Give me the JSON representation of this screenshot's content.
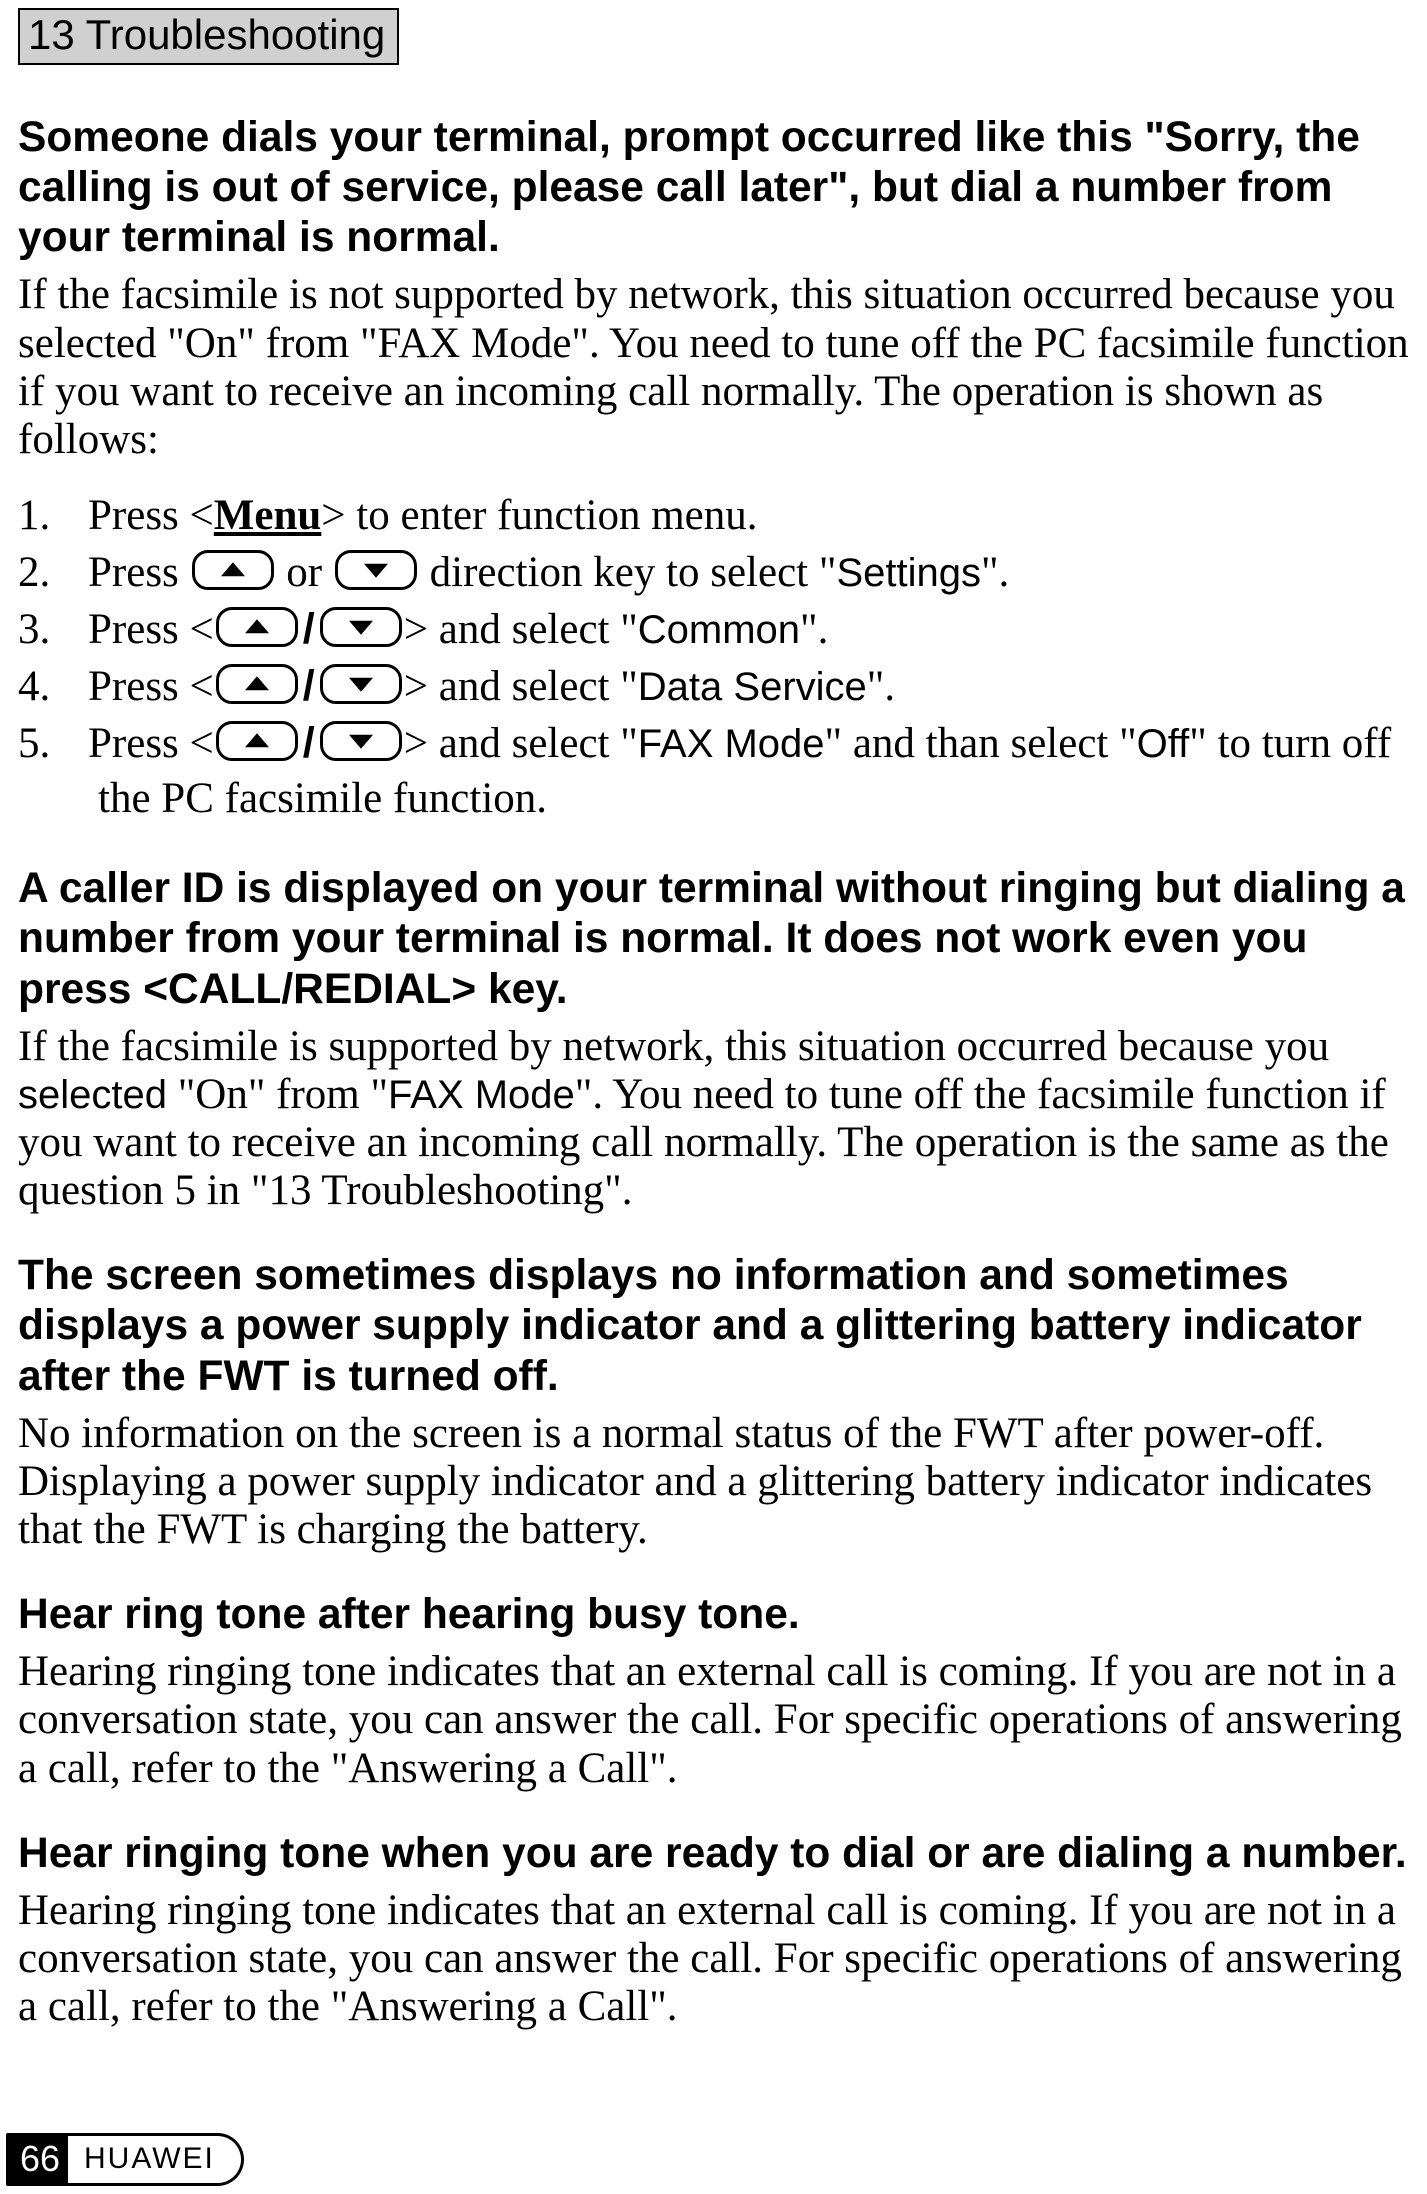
{
  "chapter": {
    "label": "13  Troubleshooting"
  },
  "s1": {
    "heading": "Someone dials your terminal, prompt occurred like this \"Sorry, the calling is out of service, please call later\", but dial a number from your terminal is normal.",
    "body": "If the facsimile is not supported by network, this situation occurred because you selected \"On\" from \"FAX Mode\". You need to tune off the PC facsimile function if you want to receive an incoming call normally. The operation is shown as follows:",
    "steps": {
      "n1": "1.",
      "n2": "2.",
      "n3": "3.",
      "n4": "4.",
      "n5": "5.",
      "t1a": "Press <",
      "t1b": "Menu",
      "t1c": "> to enter function menu.",
      "t2a": "Press ",
      "t2b": " or ",
      "t2c": " direction key to select \"",
      "t2d": "Settings",
      "t2e": "\".",
      "t3a": "Press <",
      "t3b": "> and select \"",
      "t3c": "Common",
      "t3d": "\".",
      "t4a": "Press <",
      "t4b": "> and select \"",
      "t4c": "Data Service",
      "t4d": "\".",
      "t5a": "Press <",
      "t5b": "> and select \"",
      "t5c": "FAX Mode",
      "t5d": "\" and than select \"",
      "t5e": "Off",
      "t5f": "\" to turn off the PC facsimile function.",
      "slash": "/"
    }
  },
  "s2": {
    "heading": "A caller ID is displayed on your terminal without ringing but dialing a number from your terminal is normal. It does not work even you press <CALL/REDIAL> key.",
    "body_a": "If the facsimile is supported by network, this situation occurred because you ",
    "body_b": "selected",
    "body_c": " \"On\" from \"",
    "body_d": "FAX Mode",
    "body_e": "\". You need to tune off the facsimile function if you want to receive an incoming call normally. The operation is the same as the question 5 in \"13  Troubleshooting\"."
  },
  "s3": {
    "heading": "The screen sometimes displays no information and sometimes displays a power supply indicator and a glittering battery indicator after the FWT is turned off.",
    "body": "No information on the screen is a normal status of the FWT after power-off. Displaying a power supply indicator and a glittering battery indicator indicates that the FWT is charging the battery."
  },
  "s4": {
    "heading": "Hear ring tone after hearing busy tone.",
    "body": "Hearing ringing tone indicates that an external call is coming. If you are not in a conversation state, you can answer the call. For specific operations of answering a call, refer to the \"Answering a Call\"."
  },
  "s5": {
    "heading": "Hear ringing tone when you are ready to dial or are dialing a number.",
    "body": "Hearing ringing tone indicates that an external call is coming. If you are not in a conversation state, you can answer the call. For specific operations of answering a call, refer to the \"Answering a Call\"."
  },
  "footer": {
    "page": "66",
    "brand": "HUAWEI"
  }
}
